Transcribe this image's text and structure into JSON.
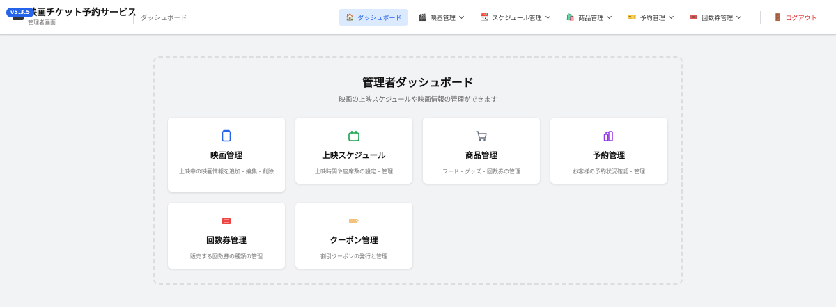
{
  "header": {
    "version": "v5.3.5",
    "title": "映画チケット予約サービス",
    "subtitle": "管理者画面",
    "breadcrumb": "ダッシュボード",
    "nav": [
      {
        "label": "ダッシュボード",
        "icon": "🏠",
        "icon_name": "home-icon",
        "active": true
      },
      {
        "label": "映画管理",
        "icon": "🎬",
        "icon_name": "clapperboard-icon"
      },
      {
        "label": "スケジュール管理",
        "icon": "📆",
        "icon_name": "calendar-icon"
      },
      {
        "label": "商品管理",
        "icon": "🛍️",
        "icon_name": "shopping-bag-icon"
      },
      {
        "label": "予約管理",
        "icon": "🎫",
        "icon_name": "ticket-icon"
      },
      {
        "label": "回数券管理",
        "icon": "🎟️",
        "icon_name": "admission-ticket-icon"
      }
    ],
    "logout": {
      "label": "ログアウト",
      "icon": "🚪",
      "icon_name": "door-icon",
      "color": "#dc2626"
    }
  },
  "main": {
    "title": "管理者ダッシュボード",
    "subtitle": "映画の上映スケジュールや映画情報の管理ができます",
    "cards": [
      {
        "title": "映画管理",
        "desc": "上映中の映画情報を追加・編集・削除",
        "icon_name": "film-icon",
        "color": "#2563eb"
      },
      {
        "title": "上映スケジュール",
        "desc": "上映時間や座席数の設定・管理",
        "icon_name": "calendar-icon",
        "color": "#16a34a"
      },
      {
        "title": "商品管理",
        "desc": "フード・グッズ・回数券の管理",
        "icon_name": "shopping-cart-icon",
        "color": "#6b7280"
      },
      {
        "title": "予約管理",
        "desc": "お客様の予約状況確認・管理",
        "icon_name": "ticket-icon",
        "color": "#9333ea"
      },
      {
        "title": "回数券管理",
        "desc": "販売する回数券の種類の管理",
        "icon_name": "admission-ticket-icon",
        "color": "#ef4444"
      },
      {
        "title": "クーポン管理",
        "desc": "割引クーポンの発行と管理",
        "icon_name": "coupon-tag-icon",
        "color": "#f4c27a"
      }
    ]
  }
}
